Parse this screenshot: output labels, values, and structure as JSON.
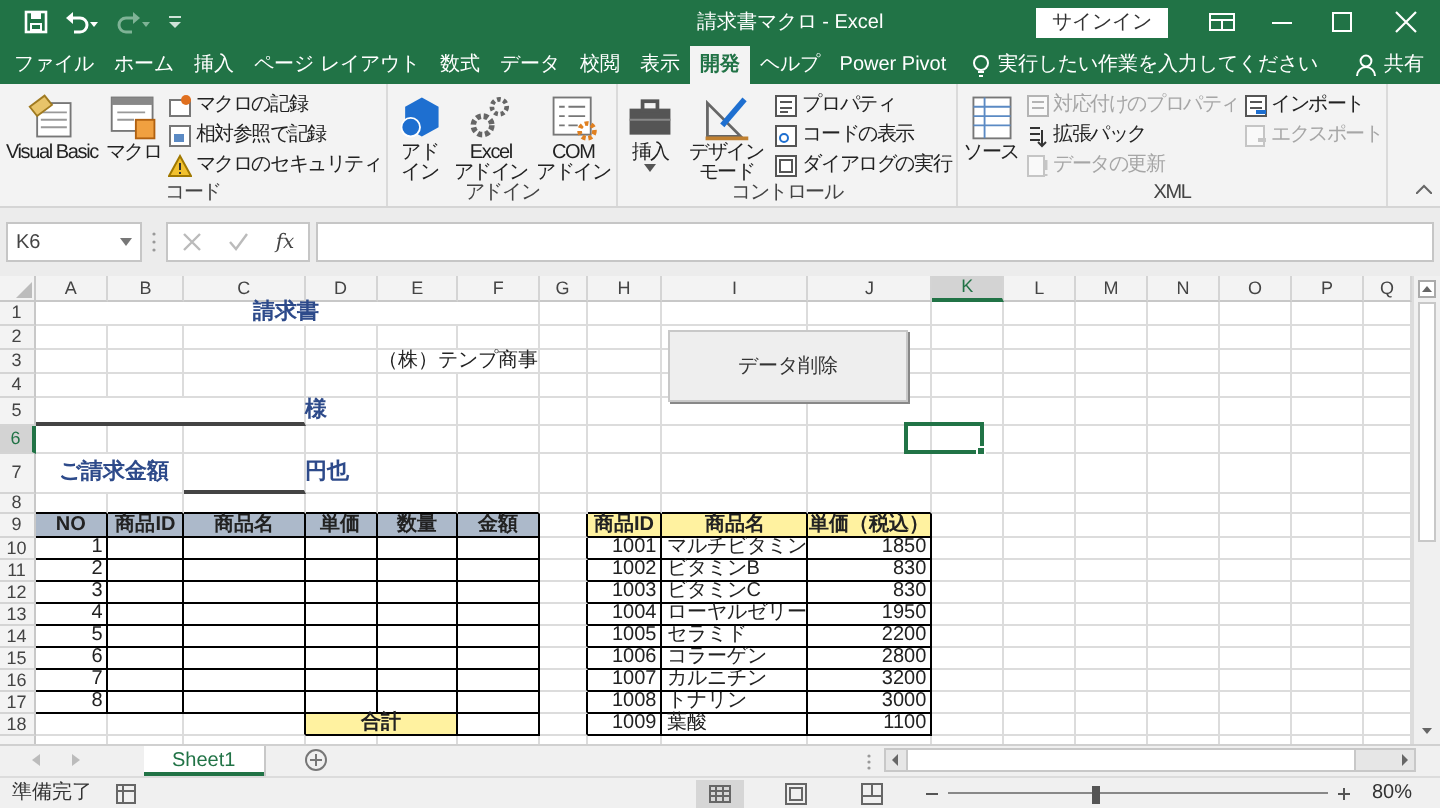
{
  "window": {
    "title": "請求書マクロ  -  Excel",
    "sign_in": "サインイン"
  },
  "tabs": [
    {
      "label": "ファイル",
      "selected": false
    },
    {
      "label": "ホーム",
      "selected": false
    },
    {
      "label": "挿入",
      "selected": false
    },
    {
      "label": "ページ レイアウト",
      "selected": false
    },
    {
      "label": "数式",
      "selected": false
    },
    {
      "label": "データ",
      "selected": false
    },
    {
      "label": "校閲",
      "selected": false
    },
    {
      "label": "表示",
      "selected": false
    },
    {
      "label": "開発",
      "selected": true
    },
    {
      "label": "ヘルプ",
      "selected": false
    },
    {
      "label": "Power Pivot",
      "selected": false
    }
  ],
  "tell_me": "実行したい作業を入力してください",
  "share": "共有",
  "ribbon": [
    {
      "label": "コード",
      "items": [
        {
          "kind": "large",
          "label": "Visual Basic"
        },
        {
          "kind": "large",
          "label": "マクロ"
        },
        {
          "kind": "stack",
          "items": [
            {
              "label": "マクロの記録",
              "disabled": false
            },
            {
              "label": "相対参照で記録",
              "disabled": false
            },
            {
              "label": "マクロのセキュリティ",
              "disabled": false
            }
          ]
        }
      ]
    },
    {
      "label": "アドイン",
      "items": [
        {
          "kind": "large",
          "label": "アドイン"
        },
        {
          "kind": "large",
          "label": "Excel\nアドイン"
        },
        {
          "kind": "large",
          "label": "COM\nアドイン"
        }
      ]
    },
    {
      "label": "コントロール",
      "items": [
        {
          "kind": "large",
          "label": "挿入",
          "dropdown": true
        },
        {
          "kind": "large",
          "label": "デザインモード"
        },
        {
          "kind": "stack",
          "items": [
            {
              "label": "プロパティ",
              "disabled": false
            },
            {
              "label": "コードの表示",
              "disabled": false
            },
            {
              "label": "ダイアログの実行",
              "disabled": false
            }
          ]
        }
      ]
    },
    {
      "label": "XML",
      "items": [
        {
          "kind": "large",
          "label": "ソース"
        },
        {
          "kind": "stack",
          "items": [
            {
              "label": "対応付けのプロパティ",
              "disabled": true
            },
            {
              "label": "拡張パック",
              "disabled": false
            },
            {
              "label": "データの更新",
              "disabled": true
            }
          ]
        },
        {
          "kind": "stack",
          "items": [
            {
              "label": "インポート",
              "disabled": false
            },
            {
              "label": "エクスポート",
              "disabled": true
            }
          ]
        }
      ]
    }
  ],
  "formula_bar": {
    "name_box": "K6",
    "function_button": "fx"
  },
  "sheet": {
    "columns": [
      {
        "label": "A",
        "selected": false
      },
      {
        "label": "B",
        "selected": false
      },
      {
        "label": "C",
        "selected": false
      },
      {
        "label": "D",
        "selected": false
      },
      {
        "label": "E",
        "selected": false
      },
      {
        "label": "F",
        "selected": false
      },
      {
        "label": "G",
        "selected": false
      },
      {
        "label": "H",
        "selected": false
      },
      {
        "label": "I",
        "selected": false
      },
      {
        "label": "J",
        "selected": false
      },
      {
        "label": "K",
        "selected": true
      },
      {
        "label": "L",
        "selected": false
      },
      {
        "label": "M",
        "selected": false
      },
      {
        "label": "N",
        "selected": false
      },
      {
        "label": "O",
        "selected": false
      },
      {
        "label": "P",
        "selected": false
      },
      {
        "label": "Q",
        "selected": false
      }
    ],
    "rows": [
      {
        "label": "1",
        "selected": false
      },
      {
        "label": "2",
        "selected": false
      },
      {
        "label": "3",
        "selected": false
      },
      {
        "label": "4",
        "selected": false
      },
      {
        "label": "5",
        "selected": false
      },
      {
        "label": "6",
        "selected": true
      },
      {
        "label": "7",
        "selected": false
      },
      {
        "label": "8",
        "selected": false
      },
      {
        "label": "9",
        "selected": false
      },
      {
        "label": "10",
        "selected": false
      },
      {
        "label": "11",
        "selected": false
      },
      {
        "label": "12",
        "selected": false
      },
      {
        "label": "13",
        "selected": false
      },
      {
        "label": "14",
        "selected": false
      },
      {
        "label": "15",
        "selected": false
      },
      {
        "label": "16",
        "selected": false
      },
      {
        "label": "17",
        "selected": false
      },
      {
        "label": "18",
        "selected": false
      }
    ],
    "title": "請求書",
    "company": "（株）テンプ商事",
    "addressee_suffix": "様",
    "amount_label": "ご請求金額",
    "amount_suffix": "円也",
    "invoice_table": {
      "columns": [
        "NO",
        "商品ID",
        "商品名",
        "単価",
        "数量",
        "金額"
      ],
      "rows": [
        "1",
        "2",
        "3",
        "4",
        "5",
        "6",
        "7",
        "8"
      ],
      "total_label": "合計"
    },
    "product_table": {
      "columns": [
        "商品ID",
        "商品名",
        "単価（税込）"
      ],
      "rows": [
        {
          "id": "1001",
          "name": "マルチビタミン",
          "price": "1850"
        },
        {
          "id": "1002",
          "name": "ビタミンB",
          "price": "830"
        },
        {
          "id": "1003",
          "name": "ビタミンC",
          "price": "830"
        },
        {
          "id": "1004",
          "name": "ローヤルゼリー",
          "price": "1950"
        },
        {
          "id": "1005",
          "name": "セラミド",
          "price": "2200"
        },
        {
          "id": "1006",
          "name": "コラーゲン",
          "price": "2800"
        },
        {
          "id": "1007",
          "name": "カルニチン",
          "price": "3200"
        },
        {
          "id": "1008",
          "name": "トナリン",
          "price": "3000"
        },
        {
          "id": "1009",
          "name": "葉酸",
          "price": "1100"
        }
      ]
    },
    "macro_button": "データ削除"
  },
  "sheet_tabs": [
    {
      "label": "Sheet1",
      "selected": true
    }
  ],
  "status_bar": {
    "status": "準備完了",
    "zoom_slider": {
      "level": 0.39
    },
    "zoom": "80%"
  }
}
